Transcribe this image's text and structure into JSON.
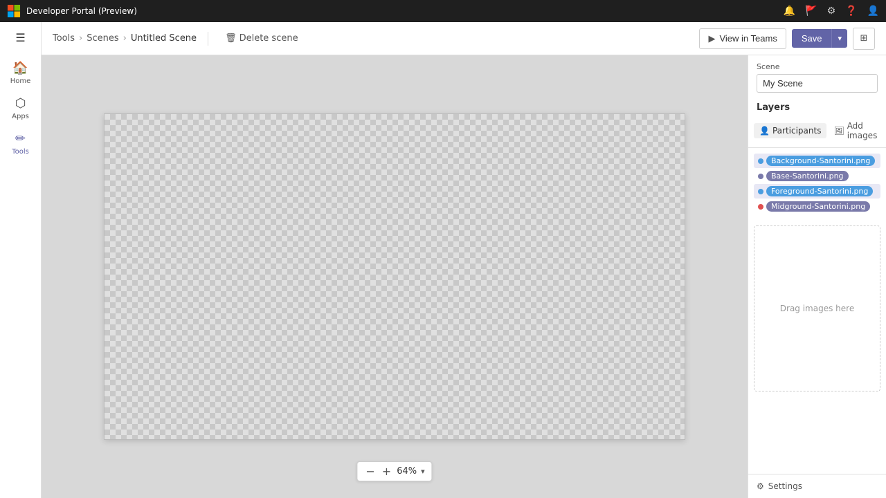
{
  "topbar": {
    "app_name": "Developer Portal (Preview)",
    "icons": [
      "notifications",
      "flag",
      "settings",
      "help",
      "profile"
    ]
  },
  "sidebar": {
    "items": [
      {
        "id": "home",
        "label": "Home",
        "icon": "🏠"
      },
      {
        "id": "apps",
        "label": "Apps",
        "icon": "⬡"
      },
      {
        "id": "tools",
        "label": "Tools",
        "icon": "✏"
      }
    ]
  },
  "breadcrumb": {
    "items": [
      "Tools",
      "Scenes",
      "Untitled Scene"
    ],
    "delete_label": "Delete scene"
  },
  "toolbar": {
    "view_in_teams_label": "View in Teams",
    "save_label": "Save"
  },
  "panel": {
    "scene_label": "Scene",
    "scene_name": "My Scene",
    "layers_label": "Layers",
    "participants_tab": "Participants",
    "add_images_tab": "Add images",
    "layers": [
      {
        "id": "bg",
        "name": "Background-Santorini.png",
        "color": "#4a9de0"
      },
      {
        "id": "base",
        "name": "Base-Santorini.png",
        "color": "#7a7aaa"
      },
      {
        "id": "fg",
        "name": "Foreground-Santorini.png",
        "color": "#4a9de0"
      },
      {
        "id": "mid",
        "name": "Midground-Santorini.png",
        "color": "#e05050"
      }
    ],
    "drag_images_label": "Drag images here",
    "settings_label": "Settings"
  },
  "canvas": {
    "zoom_level": "64%"
  }
}
